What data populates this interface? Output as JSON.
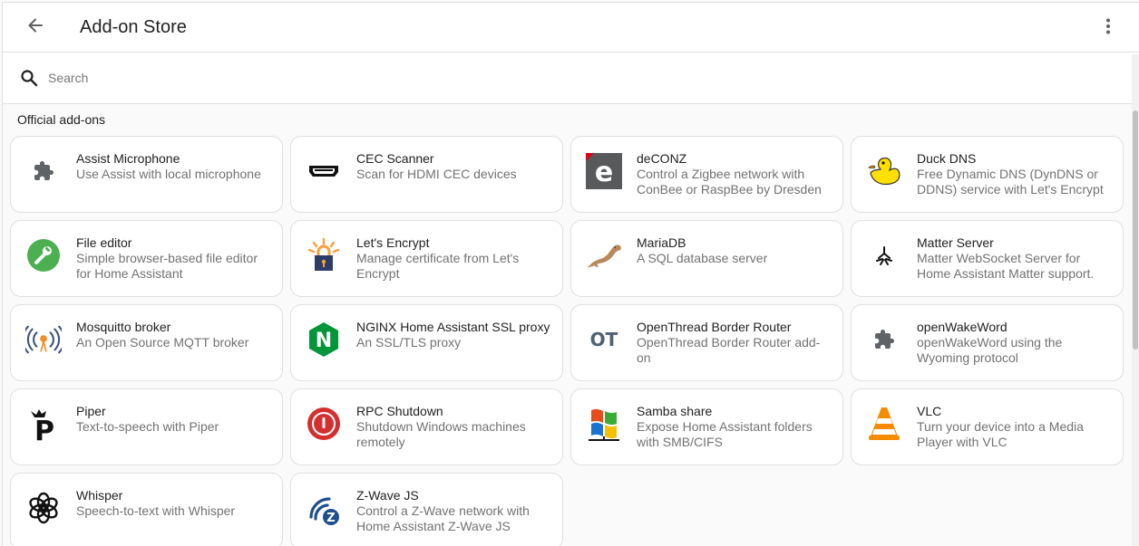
{
  "header": {
    "title": "Add-on Store",
    "back_icon": "arrow-left-icon",
    "menu_icon": "dots-vertical-icon"
  },
  "search": {
    "placeholder": "Search",
    "value": ""
  },
  "section": {
    "title": "Official add-ons"
  },
  "addons": [
    {
      "name": "Assist Microphone",
      "description": "Use Assist with local microphone",
      "icon": "puzzle-icon"
    },
    {
      "name": "CEC Scanner",
      "description": "Scan for HDMI CEC devices",
      "icon": "hdmi-port-icon"
    },
    {
      "name": "deCONZ",
      "description": "Control a Zigbee network with ConBee or RaspBee by Dresden",
      "icon": "deconz-logo-icon"
    },
    {
      "name": "Duck DNS",
      "description": "Free Dynamic DNS (DynDNS or DDNS) service with Let's Encrypt",
      "icon": "duck-icon"
    },
    {
      "name": "File editor",
      "description": "Simple browser-based file editor for Home Assistant",
      "icon": "wrench-icon"
    },
    {
      "name": "Let's Encrypt",
      "description": "Manage certificate from Let's Encrypt",
      "icon": "padlock-icon"
    },
    {
      "name": "MariaDB",
      "description": "A SQL database server",
      "icon": "seal-icon"
    },
    {
      "name": "Matter Server",
      "description": "Matter WebSocket Server for Home Assistant Matter support.",
      "icon": "matter-logo-icon"
    },
    {
      "name": "Mosquitto broker",
      "description": "An Open Source MQTT broker",
      "icon": "antenna-icon"
    },
    {
      "name": "NGINX Home Assistant SSL proxy",
      "description": "An SSL/TLS proxy",
      "icon": "nginx-logo-icon"
    },
    {
      "name": "OpenThread Border Router",
      "description": "OpenThread Border Router add-on",
      "icon": "openthread-logo-icon"
    },
    {
      "name": "openWakeWord",
      "description": "openWakeWord using the Wyoming protocol",
      "icon": "puzzle-icon"
    },
    {
      "name": "Piper",
      "description": "Text-to-speech with Piper",
      "icon": "piper-logo-icon"
    },
    {
      "name": "RPC Shutdown",
      "description": "Shutdown Windows machines remotely",
      "icon": "power-icon"
    },
    {
      "name": "Samba share",
      "description": "Expose Home Assistant folders with SMB/CIFS",
      "icon": "windows-network-icon"
    },
    {
      "name": "VLC",
      "description": "Turn your device into a Media Player with VLC",
      "icon": "traffic-cone-icon"
    },
    {
      "name": "Whisper",
      "description": "Speech-to-text with Whisper",
      "icon": "openai-logo-icon"
    },
    {
      "name": "Z-Wave JS",
      "description": "Control a Z-Wave network with Home Assistant Z-Wave JS",
      "icon": "zwave-logo-icon"
    }
  ],
  "logo_text": {
    "deconz": "e",
    "nginx": "N",
    "openthread": "OT",
    "piper": "P",
    "zwave": "Z"
  },
  "colors": {
    "nginx_green": "#009639",
    "file_editor_green": "#4caf50",
    "rpc_red": "#d32f2f",
    "zwave_blue": "#1d4f91",
    "vlc_orange": "#f48b00",
    "duck_yellow": "#ffe000",
    "deconz_gray": "#58595b"
  }
}
